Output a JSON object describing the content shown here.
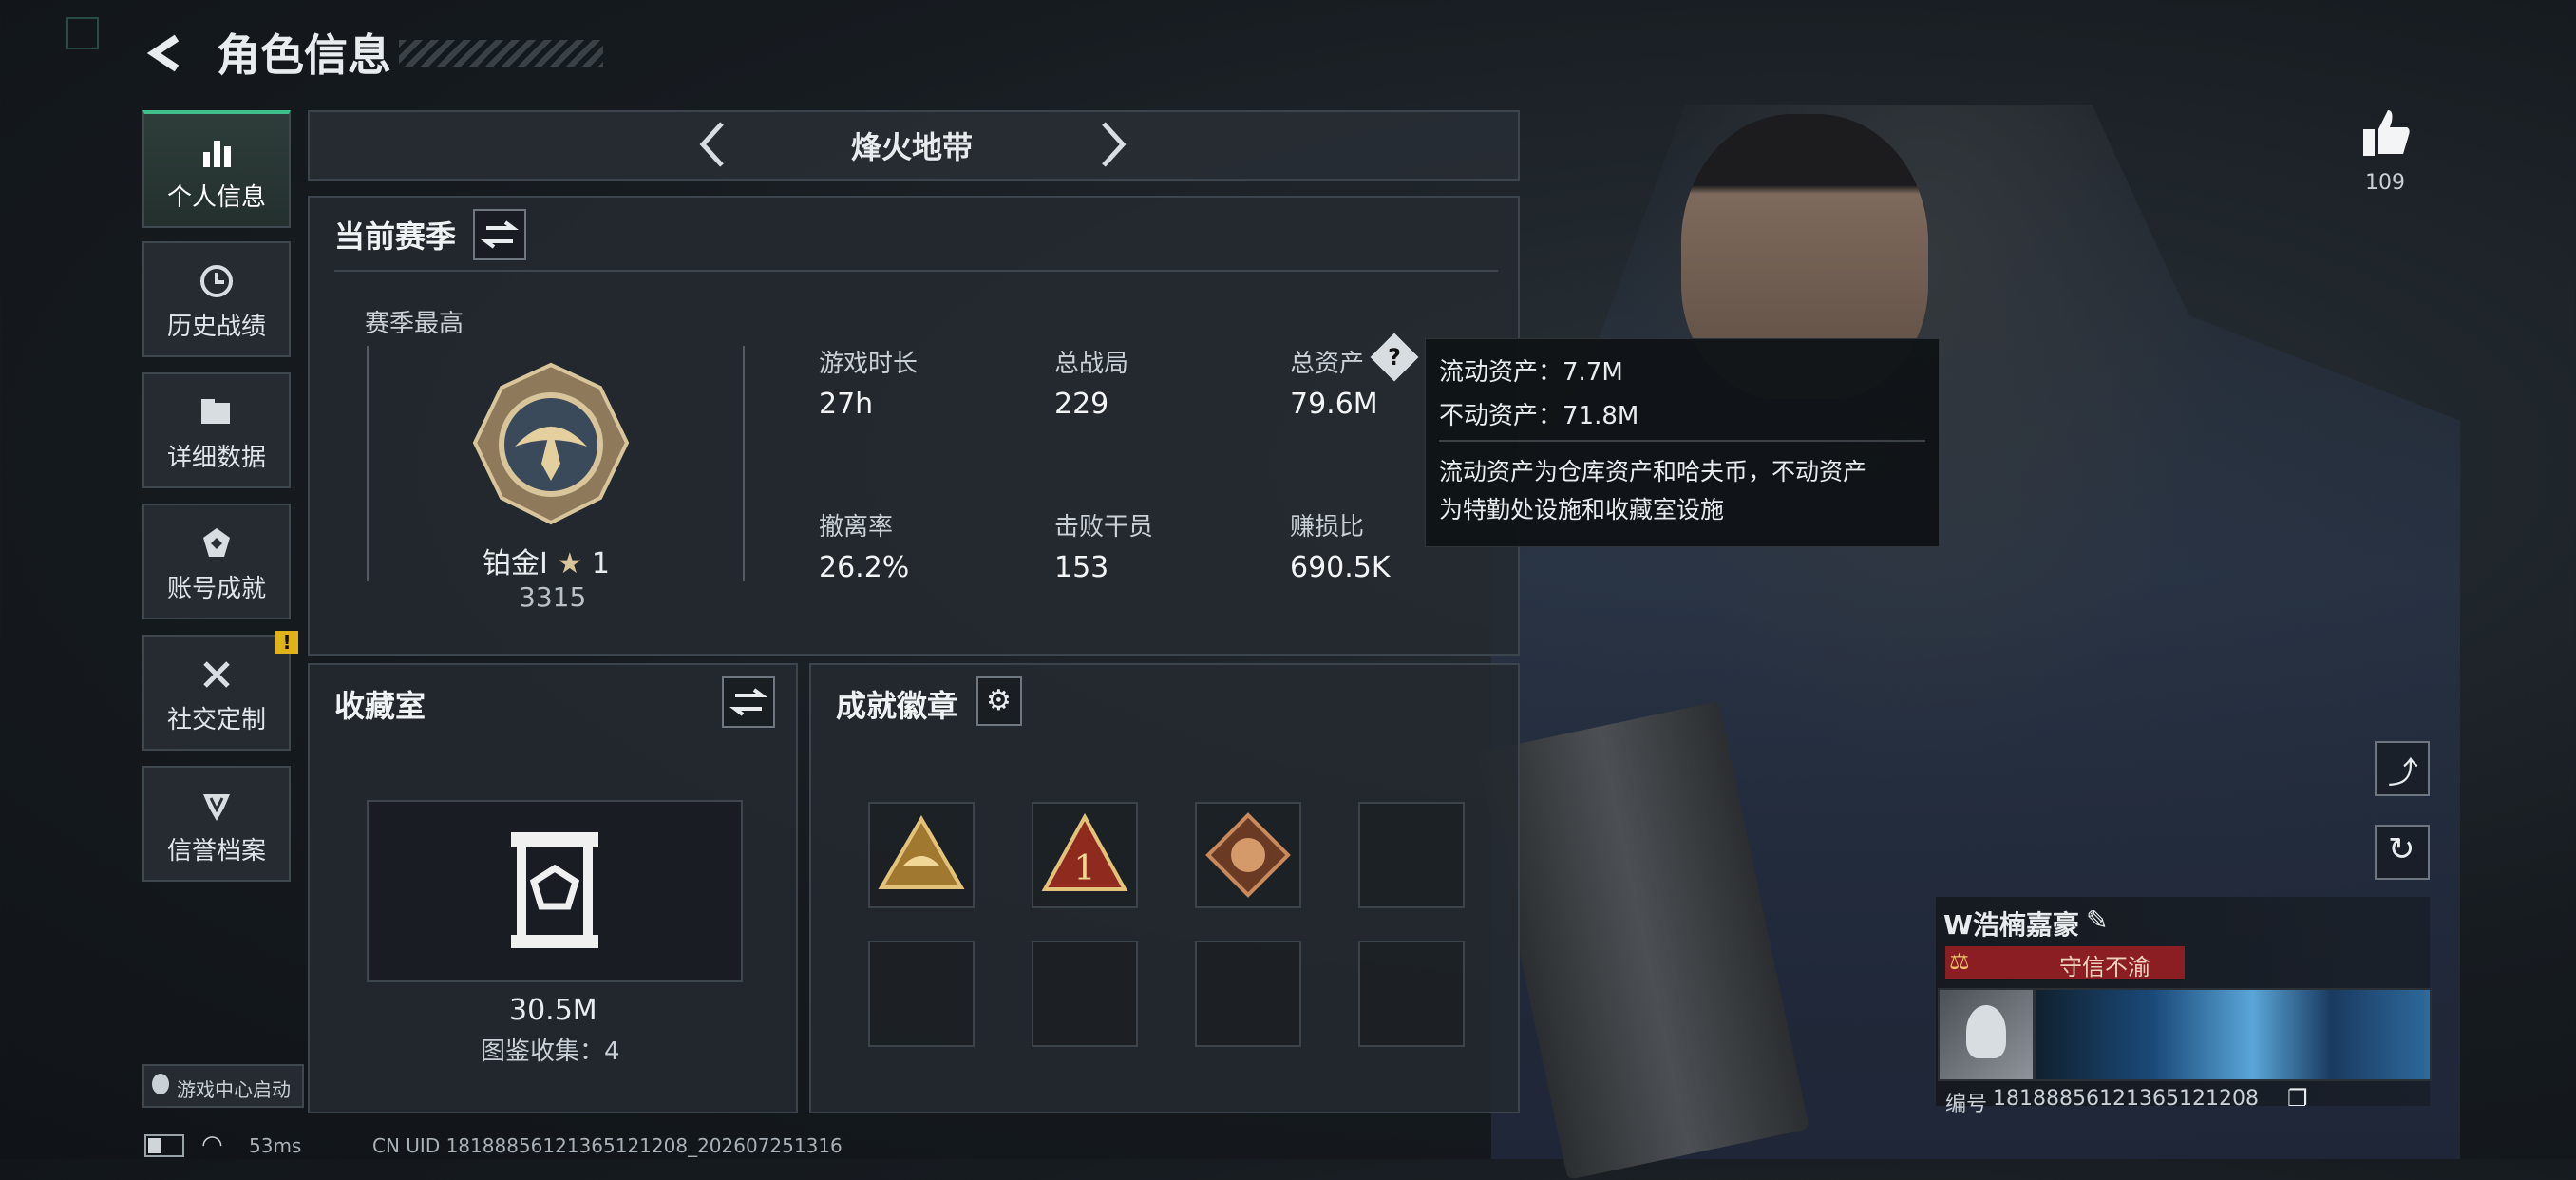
{
  "header": {
    "title": "角色信息"
  },
  "nav": [
    {
      "label": "个人信息",
      "icon": "bar-chart-icon",
      "active": true
    },
    {
      "label": "历史战绩",
      "icon": "clock-icon"
    },
    {
      "label": "详细数据",
      "icon": "folder-icon"
    },
    {
      "label": "账号成就",
      "icon": "achievement-icon"
    },
    {
      "label": "社交定制",
      "icon": "tools-icon"
    },
    {
      "label": "信誉档案",
      "icon": "credit-icon"
    }
  ],
  "mode": {
    "title": "烽火地带"
  },
  "season": {
    "section_title": "当前赛季",
    "highest_label": "赛季最高",
    "rank_name": "铂金I",
    "rank_stars": "1",
    "rank_score": "3315",
    "stats": [
      {
        "label": "游戏时长",
        "value": "27h"
      },
      {
        "label": "总战局",
        "value": "229"
      },
      {
        "label": "总资产",
        "value": "79.6M"
      },
      {
        "label": "撤离率",
        "value": "26.2%"
      },
      {
        "label": "击败干员",
        "value": "153"
      },
      {
        "label": "赚损比",
        "value": "690.5K"
      }
    ]
  },
  "tooltip": {
    "line1": "流动资产：7.7M",
    "line2": "不动资产：71.8M",
    "desc1": "流动资产为仓库资产和哈夫币，不动资产",
    "desc2": "为特勤处设施和收藏室设施"
  },
  "collection": {
    "title": "收藏室",
    "value": "30.5M",
    "count_label": "图鉴收集：4"
  },
  "badges": {
    "title": "成就徽章"
  },
  "likes": {
    "count": "109"
  },
  "profile": {
    "name": "W浩楠嘉豪",
    "credit": "守信不渝",
    "id_label": "编号",
    "id": "181888561213651212​08"
  },
  "footer": {
    "game_center": "游戏中心启动",
    "ping": "53ms",
    "uid": "CN UID 181888561213651212​08_202607251316"
  },
  "colors": {
    "accent": "#3fbf8a",
    "credit_bg": "#8b1e22",
    "tooltip_bg": "#0f1316"
  }
}
